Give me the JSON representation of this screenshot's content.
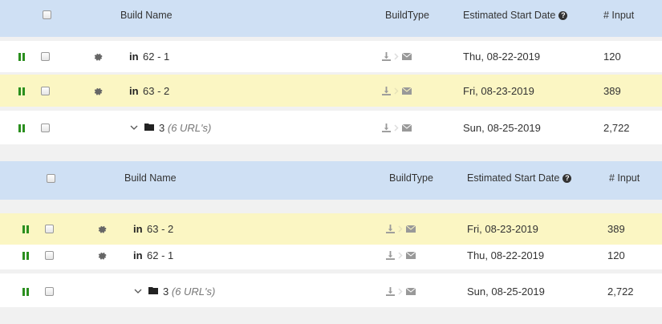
{
  "header": {
    "build_name": "Build Name",
    "build_type": "BuildType",
    "start_date": "Estimated Start Date",
    "input": "# Input",
    "help": "?"
  },
  "icons": {
    "linkedin": "in",
    "pause": "pause-icon",
    "gear": "gear-icon",
    "download": "download-icon",
    "chevron_right": "chevron-right-icon",
    "mail": "mail-icon",
    "chevron_down": "chevron-down-icon",
    "folder": "folder-icon"
  },
  "colors": {
    "header_bg": "#cfe0f4",
    "highlight_row": "#fbf6c3",
    "pause_green": "#2a8f1e"
  },
  "table1": {
    "rows": [
      {
        "name": "62 - 1",
        "date": "Thu, 08-22-2019",
        "input": "120"
      },
      {
        "name": "63 - 2",
        "date": "Fri, 08-23-2019",
        "input": "389"
      },
      {
        "name": "3",
        "sub": "(6 URL's)",
        "date": "Sun, 08-25-2019",
        "input": "2,722"
      }
    ]
  },
  "table2": {
    "rows": [
      {
        "name": "63 - 2",
        "date": "Fri, 08-23-2019",
        "input": "389"
      },
      {
        "name": "62 - 1",
        "date": "Thu, 08-22-2019",
        "input": "120"
      },
      {
        "name": "3",
        "sub": "(6 URL's)",
        "date": "Sun, 08-25-2019",
        "input": "2,722"
      }
    ]
  }
}
